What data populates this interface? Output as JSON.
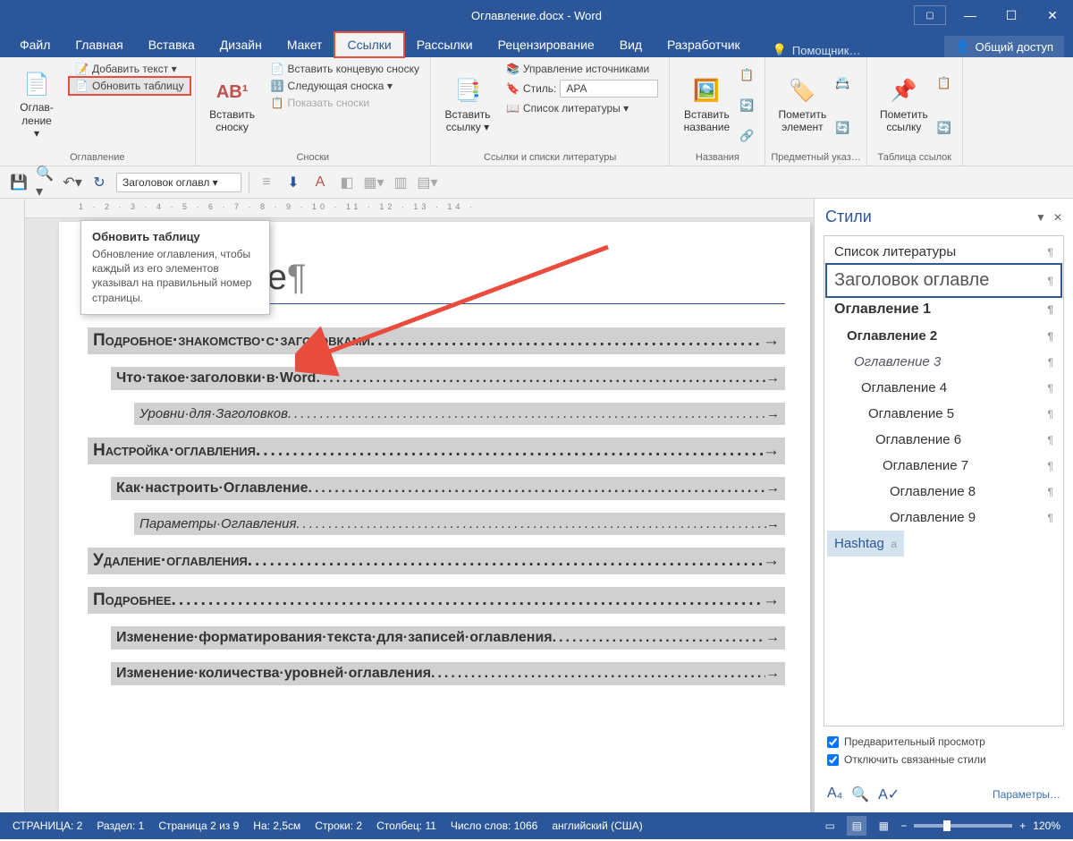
{
  "titlebar": {
    "title": "Оглавление.docx - Word"
  },
  "tabs": [
    "Файл",
    "Главная",
    "Вставка",
    "Дизайн",
    "Макет",
    "Ссылки",
    "Рассылки",
    "Рецензирование",
    "Вид",
    "Разработчик"
  ],
  "activeTab": "Ссылки",
  "tellMe": "Помощник…",
  "share": "Общий доступ",
  "groups": {
    "toc": {
      "label": "Оглавление",
      "big": "Оглав­ление",
      "add": "Добавить текст ▾",
      "update": "Обновить таблицу"
    },
    "footnotes": {
      "label": "Сноски",
      "big": "Вставить\nсноску",
      "ab": "AB¹",
      "end": "Вставить концевую сноску",
      "next": "Следующая сноска ▾",
      "show": "Показать сноски"
    },
    "cite": {
      "label": "Ссылки и списки литературы",
      "big": "Вставить\nссылку ▾",
      "manage": "Управление источниками",
      "style": "Стиль:",
      "styleVal": "APA",
      "bib": "Список литературы ▾"
    },
    "caption": {
      "label": "Названия",
      "big": "Вставить\nназвание"
    },
    "index": {
      "label": "Предметный указ…",
      "big": "Пометить\nэлемент"
    },
    "toa": {
      "label": "Таблица ссылок",
      "big": "Пометить\nссылку"
    }
  },
  "tooltip": {
    "title": "Обновить таблицу",
    "body": "Обновление оглавления, чтобы каждый из его элементов указывал на правильный номер страницы."
  },
  "qat": {
    "styleSel": "Заголовок оглавл ▾"
  },
  "ruler": "1 · 2 · 3 · 4 · 5 · 6 · 7 · 8 · 9 · 10 · 11 · 12 · 13 · 14 ·",
  "doc": {
    "title": "Оглавление",
    "toc": [
      {
        "lvl": 1,
        "t": "Подробное·знакомство·с·заголовками"
      },
      {
        "lvl": 2,
        "t": "Что·такое·заголовки·в·Word"
      },
      {
        "lvl": 3,
        "t": "Уровни·для·Заголовков"
      },
      {
        "lvl": 1,
        "t": "Настройка·оглавления"
      },
      {
        "lvl": 2,
        "t": "Как·настроить·Оглавление"
      },
      {
        "lvl": 3,
        "t": "Параметры·Оглавления"
      },
      {
        "lvl": 1,
        "t": "Удаление·оглавления"
      },
      {
        "lvl": 1,
        "t": "Подробнее"
      },
      {
        "lvl": 2,
        "t": "Изменение·форматирования·текста·для·записей·оглавления"
      },
      {
        "lvl": 2,
        "t": "Изменение·количества·уровней·оглавления"
      }
    ]
  },
  "stylesPane": {
    "title": "Стили",
    "items": [
      {
        "t": "Список литературы",
        "cls": ""
      },
      {
        "t": "Заголовок оглавле",
        "cls": "sel"
      },
      {
        "t": "Оглавление 1",
        "cls": "bold",
        "indent": 0
      },
      {
        "t": "Оглавление 2",
        "cls": "bold2",
        "indent": 14
      },
      {
        "t": "Оглавление 3",
        "cls": "it",
        "indent": 22
      },
      {
        "t": "Оглавление 4",
        "cls": "",
        "indent": 30
      },
      {
        "t": "Оглавление 5",
        "cls": "",
        "indent": 38
      },
      {
        "t": "Оглавление 6",
        "cls": "",
        "indent": 46
      },
      {
        "t": "Оглавление 7",
        "cls": "",
        "indent": 54
      },
      {
        "t": "Оглавление 8",
        "cls": "",
        "indent": 62
      },
      {
        "t": "Оглавление 9",
        "cls": "",
        "indent": 62
      },
      {
        "t": "Hashtag",
        "cls": "hash",
        "indent": 0,
        "mark": "a"
      }
    ],
    "preview": "Предварительный просмотр",
    "disable": "Отключить связанные стили",
    "params": "Параметры…"
  },
  "status": {
    "page": "СТРАНИЦА: 2",
    "section": "Раздел: 1",
    "pageOf": "Страница 2 из 9",
    "at": "На: 2,5см",
    "line": "Строки: 2",
    "col": "Столбец: 11",
    "words": "Число слов: 1066",
    "lang": "английский (США)",
    "zoom": "120%"
  }
}
